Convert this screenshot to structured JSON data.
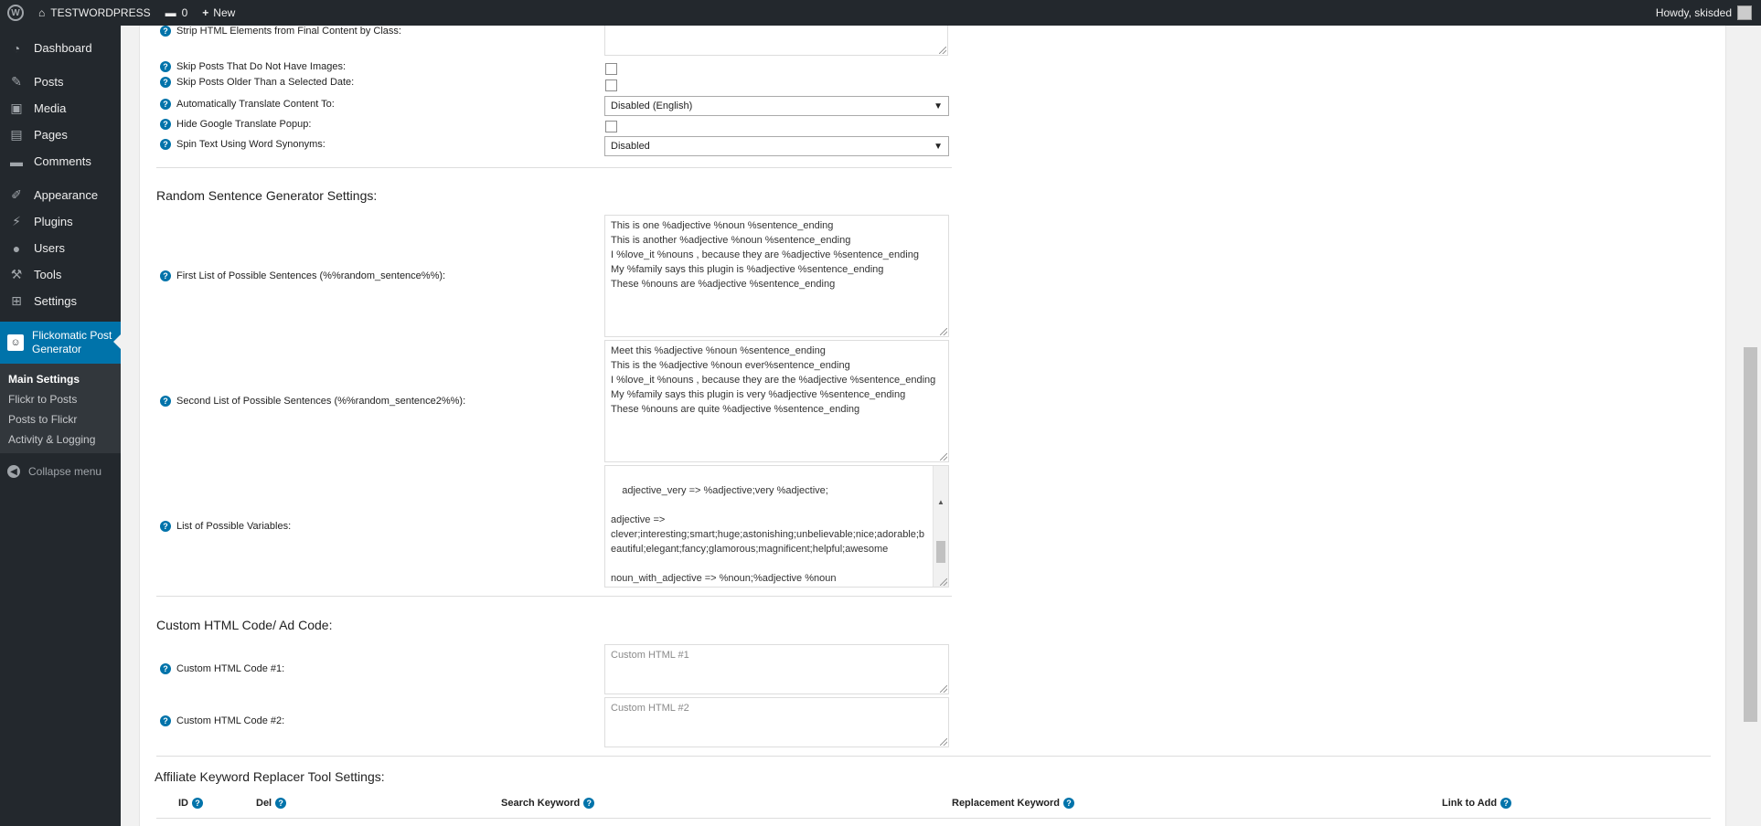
{
  "adminbar": {
    "site_name": "TESTWORDPRESS",
    "comments_count": "0",
    "new_label": "New",
    "howdy": "Howdy, skisded"
  },
  "sidebar": {
    "items": [
      {
        "label": "Dashboard",
        "icon": "dashboard-icon"
      },
      {
        "label": "Posts",
        "icon": "pin-icon"
      },
      {
        "label": "Media",
        "icon": "media-icon"
      },
      {
        "label": "Pages",
        "icon": "page-icon"
      },
      {
        "label": "Comments",
        "icon": "comment-icon"
      },
      {
        "label": "Appearance",
        "icon": "brush-icon"
      },
      {
        "label": "Plugins",
        "icon": "plugin-icon"
      },
      {
        "label": "Users",
        "icon": "user-icon"
      },
      {
        "label": "Tools",
        "icon": "wrench-icon"
      },
      {
        "label": "Settings",
        "icon": "settings-icon"
      }
    ],
    "current": {
      "label": "Flickomatic Post Generator"
    },
    "submenu": [
      "Main Settings",
      "Flickr to Posts",
      "Posts to Flickr",
      "Activity & Logging"
    ],
    "collapse": "Collapse menu"
  },
  "settings": {
    "strip_html": "Strip HTML Elements from Final Content by Class:",
    "skip_no_images": "Skip Posts That Do Not Have Images:",
    "skip_older": "Skip Posts Older Than a Selected Date:",
    "auto_translate": "Automatically Translate Content To:",
    "auto_translate_value": "Disabled (English)",
    "hide_translate": "Hide Google Translate Popup:",
    "spin_text": "Spin Text Using Word Synonyms:",
    "spin_text_value": "Disabled"
  },
  "random_sentence": {
    "heading": "Random Sentence Generator Settings:",
    "first_label": "First List of Possible Sentences (%%random_sentence%%):",
    "first_value": "This is one %adjective %noun %sentence_ending\nThis is another %adjective %noun %sentence_ending\nI %love_it %nouns , because they are %adjective %sentence_ending\nMy %family says this plugin is %adjective %sentence_ending\nThese %nouns are %adjective %sentence_ending",
    "second_label": "Second List of Possible Sentences (%%random_sentence2%%):",
    "second_value": "Meet this %adjective %noun %sentence_ending\nThis is the %adjective %noun ever%sentence_ending\nI %love_it %nouns , because they are the %adjective %sentence_ending\nMy %family says this plugin is very %adjective %sentence_ending\nThese %nouns are quite %adjective %sentence_ending",
    "vars_label": "List of Possible Variables:",
    "vars_value": "adjective_very => %adjective;very %adjective;\n\nadjective =>\nclever;interesting;smart;huge;astonishing;unbelievable;nice;adorable;beautiful;elegant;fancy;glamorous;magnificent;helpful;awesome\n\nnoun_with_adjective => %noun;%adjective %noun"
  },
  "custom_html": {
    "heading": "Custom HTML Code/ Ad Code:",
    "code1_label": "Custom HTML Code #1:",
    "code1_placeholder": "Custom HTML #1",
    "code2_label": "Custom HTML Code #2:",
    "code2_placeholder": "Custom HTML #2"
  },
  "affiliate": {
    "heading": "Affiliate Keyword Replacer Tool Settings:",
    "columns": [
      "ID",
      "Del",
      "Search Keyword",
      "Replacement Keyword",
      "Link to Add"
    ]
  },
  "colors": {
    "accent": "#0073aa",
    "sidebar_bg": "#23282d"
  }
}
